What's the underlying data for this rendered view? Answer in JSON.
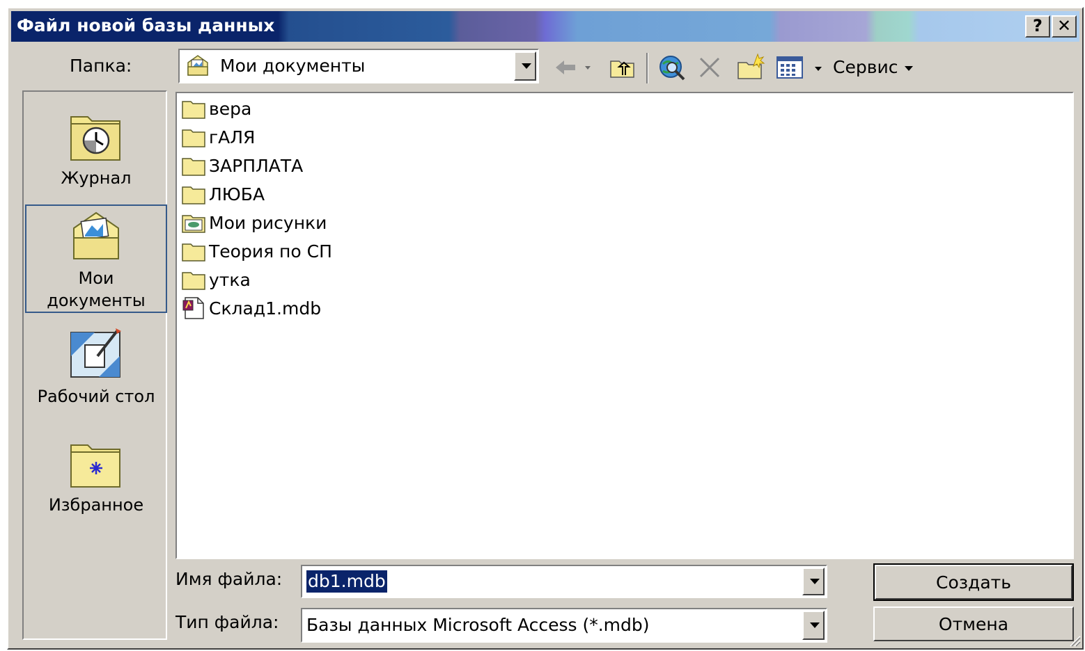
{
  "window": {
    "title": "Файл новой базы данных",
    "help_btn": "?",
    "close_btn": "✕"
  },
  "toolbar": {
    "folder_label": "Папка:",
    "folder_value": "Мои документы",
    "service_label": "Сервис"
  },
  "places": [
    {
      "label": "Журнал",
      "icon": "history-icon"
    },
    {
      "label": "Мои документы",
      "icon": "my-documents-icon",
      "selected": true
    },
    {
      "label": "Рабочий стол",
      "icon": "desktop-icon"
    },
    {
      "label": "Избранное",
      "icon": "favorites-icon"
    }
  ],
  "files": [
    {
      "name": "вера",
      "type": "folder"
    },
    {
      "name": "гАЛЯ",
      "type": "folder"
    },
    {
      "name": "ЗАРПЛАТА",
      "type": "folder"
    },
    {
      "name": "ЛЮБА",
      "type": "folder"
    },
    {
      "name": "Мои рисунки",
      "type": "pictures-folder"
    },
    {
      "name": "Теория по СП",
      "type": "folder"
    },
    {
      "name": "утка",
      "type": "folder"
    },
    {
      "name": "Склад1.mdb",
      "type": "access-db"
    }
  ],
  "form": {
    "filename_label": "Имя файла:",
    "filename_value": "db1.mdb",
    "filetype_label": "Тип файла:",
    "filetype_value": "Базы данных Microsoft Access (*.mdb)"
  },
  "buttons": {
    "create": "Создать",
    "cancel": "Отмена"
  },
  "colors": {
    "dialog_bg": "#d4d0c8",
    "title_dark": "#0a246a",
    "selection": "#0a246a",
    "folder_yellow": "#f6ea9a"
  }
}
